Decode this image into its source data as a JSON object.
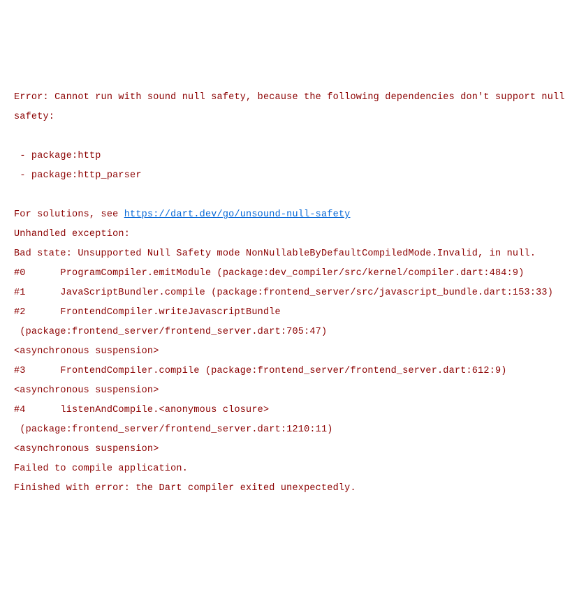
{
  "error": {
    "header": "Error: Cannot run with sound null safety, because the following dependencies don't support null safety:",
    "blank1": "",
    "pkg1": " - package:http",
    "pkg2": " - package:http_parser",
    "blank2": "",
    "solutionsPrefix": "For solutions, see ",
    "solutionsLink": "https://dart.dev/go/unsound-null-safety",
    "unhandled": "Unhandled exception:",
    "badState": "Bad state: Unsupported Null Safety mode NonNullableByDefaultCompiledMode.Invalid, in null.",
    "trace0": "#0      ProgramCompiler.emitModule (package:dev_compiler/src/kernel/compiler.dart:484:9)",
    "trace1": "#1      JavaScriptBundler.compile (package:frontend_server/src/javascript_bundle.dart:153:33)",
    "trace2a": "#2      FrontendCompiler.writeJavascriptBundle",
    "trace2b": " (package:frontend_server/frontend_server.dart:705:47)",
    "async1": "<asynchronous suspension>",
    "trace3": "#3      FrontendCompiler.compile (package:frontend_server/frontend_server.dart:612:9)",
    "async2": "<asynchronous suspension>",
    "trace4a": "#4      listenAndCompile.<anonymous closure>",
    "trace4b": " (package:frontend_server/frontend_server.dart:1210:11)",
    "async3": "<asynchronous suspension>",
    "failed": "Failed to compile application.",
    "finished": "Finished with error: the Dart compiler exited unexpectedly."
  }
}
